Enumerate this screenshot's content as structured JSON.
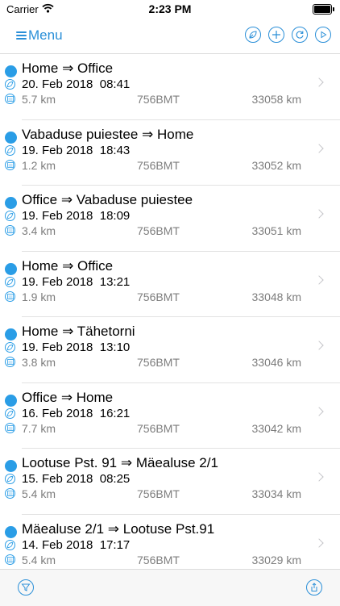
{
  "status": {
    "carrier": "Carrier",
    "time": "2:23 PM"
  },
  "nav": {
    "menu_label": "Menu",
    "icons": [
      "leaf-icon",
      "plus-icon",
      "refresh-icon",
      "play-icon"
    ]
  },
  "trips": [
    {
      "route": "Home ⇒ Office",
      "date": "20. Feb 2018  08:41",
      "distance": "5.7 km",
      "plate": "756BMT",
      "odometer": "33058 km"
    },
    {
      "route": "Vabaduse puiestee ⇒ Home",
      "date": "19. Feb 2018  18:43",
      "distance": "1.2 km",
      "plate": "756BMT",
      "odometer": "33052 km"
    },
    {
      "route": "Office ⇒ Vabaduse puiestee",
      "date": "19. Feb 2018  18:09",
      "distance": "3.4 km",
      "plate": "756BMT",
      "odometer": "33051 km"
    },
    {
      "route": "Home ⇒ Office",
      "date": "19. Feb 2018  13:21",
      "distance": "1.9 km",
      "plate": "756BMT",
      "odometer": "33048 km"
    },
    {
      "route": "Home ⇒ Tähetorni",
      "date": "19. Feb 2018  13:10",
      "distance": "3.8 km",
      "plate": "756BMT",
      "odometer": "33046 km"
    },
    {
      "route": "Office ⇒ Home",
      "date": "16. Feb 2018  16:21",
      "distance": "7.7 km",
      "plate": "756BMT",
      "odometer": "33042 km"
    },
    {
      "route": "Lootuse Pst. 91  ⇒ Mäealuse 2/1",
      "date": "15. Feb 2018  08:25",
      "distance": "5.4 km",
      "plate": "756BMT",
      "odometer": "33034 km"
    },
    {
      "route": "Mäealuse 2/1 ⇒ Lootuse Pst.91",
      "date": "14. Feb 2018  17:17",
      "distance": "5.4 km",
      "plate": "756BMT",
      "odometer": "33029 km"
    }
  ],
  "toolbar": {
    "icons": [
      "filter-icon",
      "share-icon"
    ]
  },
  "colors": {
    "accent": "#2a8fd8",
    "dot": "#2a9de6",
    "secondary_text": "#7d7d7d"
  }
}
